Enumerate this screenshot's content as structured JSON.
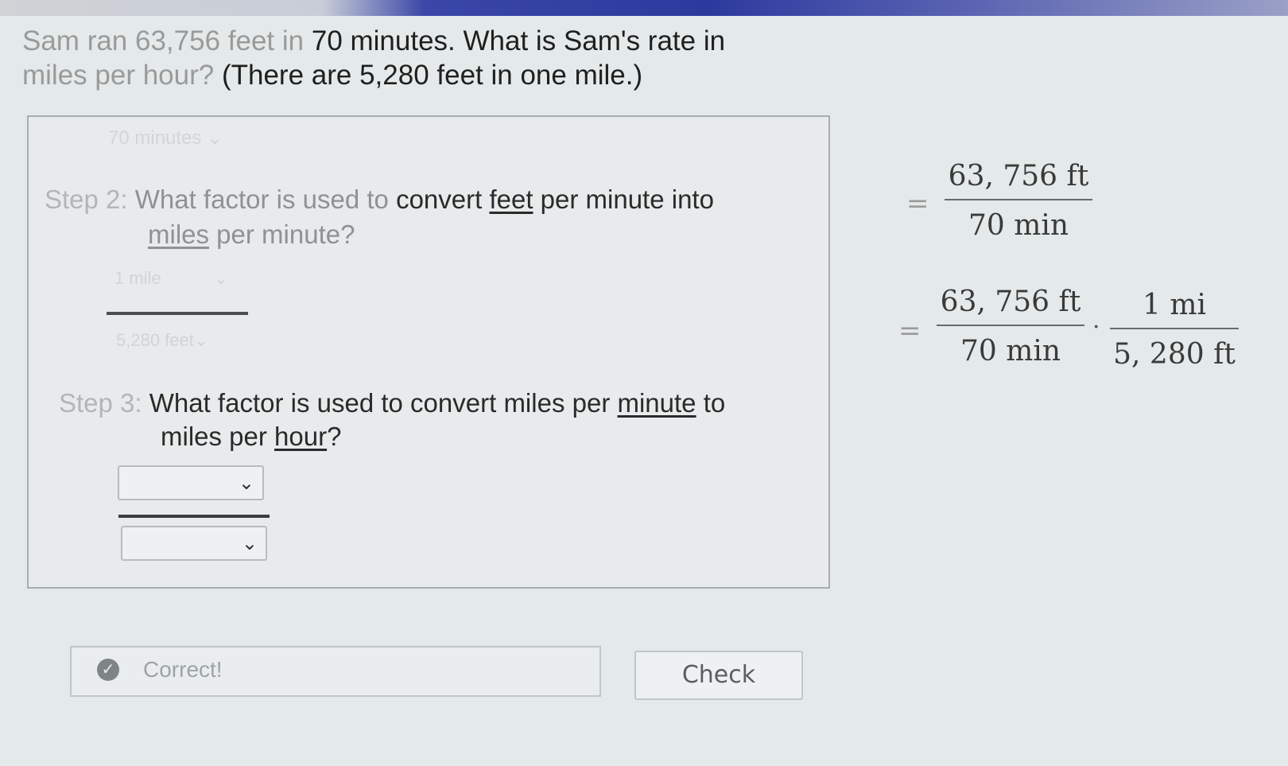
{
  "question": {
    "lead": "Sam ran 63,756 feet in",
    "rest1": " 70 minutes. What is Sam's rate in",
    "lead2": "miles per hour?",
    "rest2": " (There are 5,280 feet in one mile.)"
  },
  "step1": {
    "selected": "70 minutes"
  },
  "step2": {
    "label": "Step 2:",
    "text_a": " What factor is used to ",
    "text_b": "convert ",
    "underline1": "feet",
    "text_c": " per minute into",
    "underline2": "miles",
    "text_d": " per minute?",
    "numerator_selected": "1 mile",
    "denominator_selected": "5,280 feet"
  },
  "step3": {
    "label": "Step 3:",
    "text_a": " What factor is used to convert miles per ",
    "underline1": "minute",
    "text_b": " to",
    "text_c": "miles per ",
    "underline2": "hour",
    "text_d": "?",
    "numerator_selected": "",
    "denominator_selected": ""
  },
  "work": {
    "equals": "=",
    "line1": {
      "num": "63, 756 ft",
      "den": "70 min"
    },
    "line2": {
      "frac1": {
        "num": "63, 756 ft",
        "den": "70 min"
      },
      "dot": "·",
      "frac2": {
        "num": "1 mi",
        "den": "5, 280 ft"
      }
    }
  },
  "feedback": {
    "icon": "check-circle-icon",
    "text": "Correct!"
  },
  "check_button": {
    "label": "Check"
  }
}
